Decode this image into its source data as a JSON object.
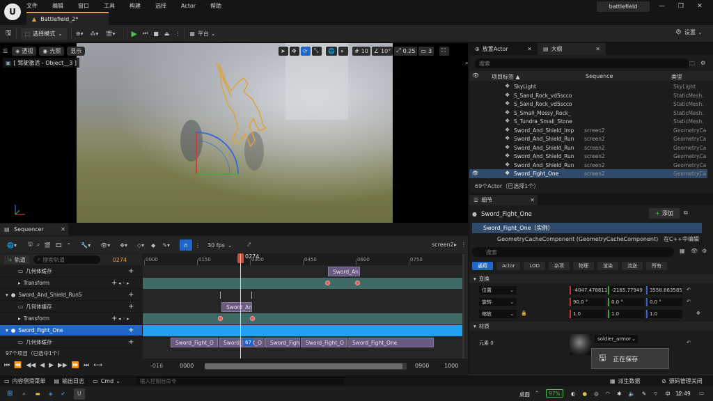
{
  "menu": [
    "文件",
    "编辑",
    "窗口",
    "工具",
    "构建",
    "选择",
    "Actor",
    "帮助"
  ],
  "doc_tab": "Battlefield_2*",
  "project_name": "battlefield",
  "toolbar": {
    "select_mode": "选择模式",
    "platform": "平台",
    "settings": "设置"
  },
  "viewport": {
    "perspective": "透视",
    "lit": "光照",
    "show": "显示",
    "pilot_label": "[ 驾驶激活 - Object__3 ]",
    "grid_size": "10",
    "rot_snap": "10°",
    "scale_snap": "0.25",
    "cam_speed": "3"
  },
  "outliner": {
    "tab_place": "放置Actor",
    "tab_outliner": "大纲",
    "search_placeholder": "搜索",
    "col_label": "项目标签 ▲",
    "col_sequence": "Sequence",
    "col_type": "类型",
    "rows": [
      {
        "label": "SkyLight",
        "seq": "",
        "type": "SkyLight",
        "sel": false
      },
      {
        "label": "S_Sand_Rock_vd5scco",
        "seq": "",
        "type": "StaticMesh.",
        "sel": false
      },
      {
        "label": "S_Sand_Rock_vd5scco",
        "seq": "",
        "type": "StaticMesh.",
        "sel": false
      },
      {
        "label": "S_Small_Mossy_Rock_",
        "seq": "",
        "type": "StaticMesh.",
        "sel": false
      },
      {
        "label": "S_Tundra_Small_Stone",
        "seq": "",
        "type": "StaticMesh.",
        "sel": false
      },
      {
        "label": "Sword_And_Shield_Imp",
        "seq": "screen2",
        "type": "GeometryCa",
        "sel": false
      },
      {
        "label": "Sword_And_Shield_Run",
        "seq": "screen2",
        "type": "GeometryCa",
        "sel": false
      },
      {
        "label": "Sword_And_Shield_Run",
        "seq": "screen2",
        "type": "GeometryCa",
        "sel": false
      },
      {
        "label": "Sword_And_Shield_Run",
        "seq": "screen2",
        "type": "GeometryCa",
        "sel": false
      },
      {
        "label": "Sword_And_Shield_Run",
        "seq": "screen2",
        "type": "GeometryCa",
        "sel": false
      },
      {
        "label": "Sword_Fight_One",
        "seq": "screen2",
        "type": "GeometryCa",
        "sel": true
      }
    ],
    "footer": "69个Actor（已选择1个）"
  },
  "details": {
    "tab": "细节",
    "actor_name": "Sword_Fight_One",
    "add": "添加",
    "instance": "Sword_Fight_One（实例）",
    "component": "GeometryCacheComponent (GeometryCacheComponent)",
    "edit_cpp": "在C++中编辑",
    "search_placeholder": "搜索",
    "filters": [
      "通用",
      "Actor",
      "LOD",
      "杂项",
      "物理",
      "渲染",
      "流送",
      "所有"
    ],
    "transform_header": "变换",
    "location_label": "位置",
    "rotation_label": "旋转",
    "scale_label": "缩放",
    "location": [
      "-4047.478811",
      "-2165.77949",
      "3558.663585"
    ],
    "rotation": [
      "90.0 °",
      "0.0 °",
      "0.0 °"
    ],
    "scale": [
      "1.0",
      "1.0",
      "1.0"
    ],
    "materials_header": "材质",
    "element0": "元素 0",
    "material_name": "soldier_armor"
  },
  "saving": "正在保存",
  "sequencer": {
    "tab": "Sequencer",
    "fps": "30 fps",
    "seq_name": "screen2",
    "add_track": "轨道",
    "search_placeholder": "搜索轨道",
    "current_frame": "0274",
    "ruler": [
      "0000",
      "0150",
      "0300",
      "0450",
      "0600",
      "0750"
    ],
    "playhead_label": "0274",
    "tracks": [
      {
        "name": "几何体缓存",
        "indent": 2,
        "sel": false
      },
      {
        "name": "Transform",
        "indent": 2,
        "sel": false
      },
      {
        "name": "Sword_And_Shield_Run5",
        "indent": 1,
        "sel": false
      },
      {
        "name": "几何体缓存",
        "indent": 2,
        "sel": false
      },
      {
        "name": "Transform",
        "indent": 2,
        "sel": false
      },
      {
        "name": "Sword_Fight_One",
        "indent": 1,
        "sel": true
      },
      {
        "name": "几何体缓存",
        "indent": 2,
        "sel": false
      }
    ],
    "clip1": "Sword_An",
    "clip2": "Sword_An",
    "fight_clips": [
      "Sword_Fight_O",
      "Sword_Fight_O",
      "Sword_Fight_O",
      "Sword_Fight_O",
      "Sword_Fight_One"
    ],
    "frame_badge": "67",
    "items_count": "97个项目（已选中1个）",
    "range_start": "-016",
    "view_start": "0000",
    "view_end": "0900",
    "range_end": "1000"
  },
  "statusbar": {
    "content_drawer": "内容侧滑菜单",
    "output_log": "输出日志",
    "cmd": "Cmd",
    "cmd_placeholder": "输入控制台命令",
    "derived": "派生数据",
    "source_control": "源码管理关闭"
  },
  "taskbar": {
    "desktop": "桌面",
    "battery": "97%",
    "time": "12:49"
  }
}
